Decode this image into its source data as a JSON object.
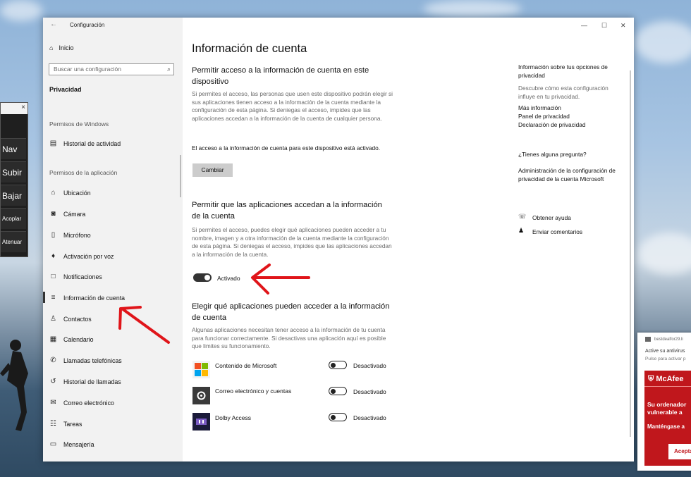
{
  "window": {
    "title": "Configuración"
  },
  "sidebar": {
    "home": "Inicio",
    "search_placeholder": "Buscar una configuración",
    "current": "Privacidad",
    "section_windows": "Permisos de Windows",
    "windows_items": [
      {
        "label": "Historial de actividad",
        "icon": "history-icon"
      }
    ],
    "section_apps": "Permisos de la aplicación",
    "items": [
      {
        "label": "Ubicación",
        "icon": "location-icon"
      },
      {
        "label": "Cámara",
        "icon": "camera-icon"
      },
      {
        "label": "Micrófono",
        "icon": "microphone-icon"
      },
      {
        "label": "Activación por voz",
        "icon": "voice-icon"
      },
      {
        "label": "Notificaciones",
        "icon": "notifications-icon"
      },
      {
        "label": "Información de cuenta",
        "icon": "account-info-icon"
      },
      {
        "label": "Contactos",
        "icon": "contacts-icon"
      },
      {
        "label": "Calendario",
        "icon": "calendar-icon"
      },
      {
        "label": "Llamadas telefónicas",
        "icon": "phone-icon"
      },
      {
        "label": "Historial de llamadas",
        "icon": "call-history-icon"
      },
      {
        "label": "Correo electrónico",
        "icon": "mail-icon"
      },
      {
        "label": "Tareas",
        "icon": "tasks-icon"
      },
      {
        "label": "Mensajería",
        "icon": "messaging-icon"
      }
    ]
  },
  "main": {
    "title": "Información de cuenta",
    "s1": {
      "heading": "Permitir acceso a la información de cuenta en este dispositivo",
      "desc": "Si permites el acceso, las personas que usen este dispositivo podrán elegir si sus aplicaciones tienen acceso a la información de la cuenta mediante la configuración de esta página. Si deniegas el acceso, impides que las aplicaciones accedan a la información de la cuenta de cualquier persona.",
      "status": "El acceso a la información de cuenta para este dispositivo está activado.",
      "button": "Cambiar"
    },
    "s2": {
      "heading": "Permitir que las aplicaciones accedan a la información de la cuenta",
      "desc": "Si permites el acceso, puedes elegir qué aplicaciones pueden acceder a tu nombre, imagen y a otra información de la cuenta mediante la configuración de esta página. Si deniegas el acceso, impides que las aplicaciones accedan a la información de la cuenta.",
      "toggle_label": "Activado"
    },
    "s3": {
      "heading": "Elegir qué aplicaciones pueden acceder a la información de cuenta",
      "desc": "Algunas aplicaciones necesitan tener acceso a la información de tu cuenta para funcionar correctamente. Si desactivas una aplicación aquí es posible que limites su funcionamiento.",
      "apps": [
        {
          "name": "Contenido de Microsoft",
          "state": "Desactivado"
        },
        {
          "name": "Correo electrónico y cuentas",
          "state": "Desactivado"
        },
        {
          "name": "Dolby Access",
          "state": "Desactivado"
        }
      ]
    }
  },
  "right": {
    "info_title": "Información sobre tus opciones de privacidad",
    "info_desc": "Descubre cómo esta configuración influye en tu privacidad.",
    "links": [
      "Más información",
      "Panel de privacidad",
      "Declaración de privacidad"
    ],
    "question": "¿Tienes alguna pregunta?",
    "admin_link": "Administración de la configuración de privacidad de la cuenta Microsoft",
    "help": "Obtener ayuda",
    "feedback": "Enviar comentarios"
  },
  "mini_panel": {
    "buttons": [
      "Nav",
      "Subir",
      "Bajar",
      "Acoplar",
      "Atenuar"
    ],
    "close": "×"
  },
  "ad": {
    "site": "bestdealfor29.li",
    "line1": "Active su antivirus",
    "line2": "Pulse para activar p",
    "brand": "McAfee",
    "text1": "Su ordenador",
    "text2": "vulnerable a",
    "text3": "Manténgase a",
    "accept": "Acepta"
  },
  "colors": {
    "accent_red": "#c0171c",
    "annotation_arrow": "#e0151a"
  }
}
